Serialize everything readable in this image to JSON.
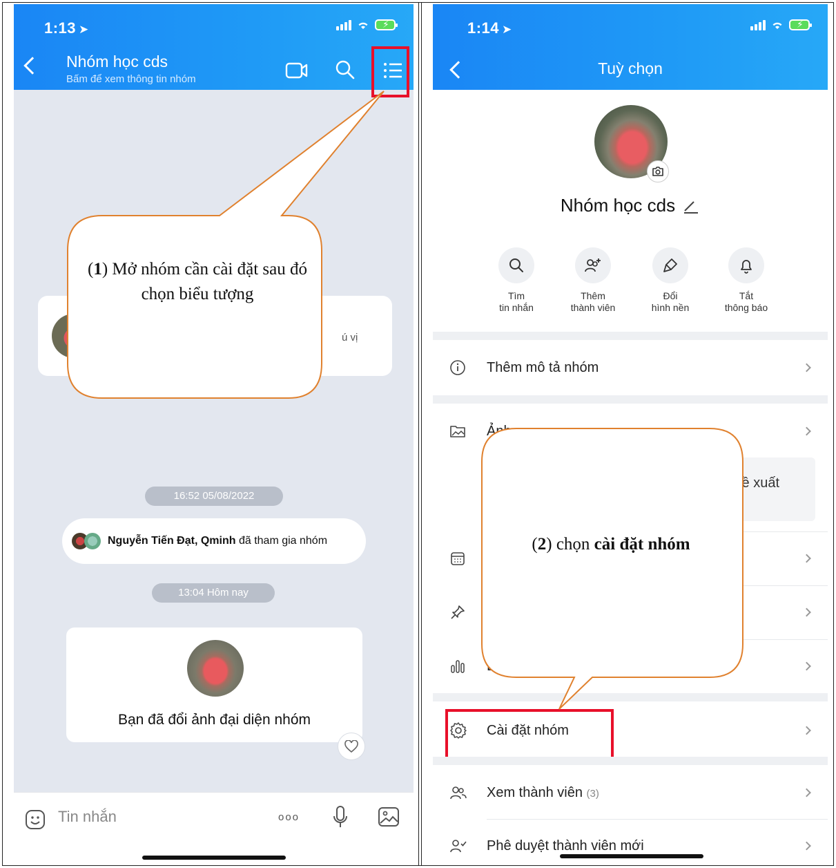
{
  "left": {
    "status_time": "1:13",
    "header": {
      "title": "Nhóm học cds",
      "subtitle": "Bấm để xem thông tin nhóm"
    },
    "messages": {
      "top_card_tail": "ú vị",
      "date_1": "16:52 05/08/2022",
      "join_names": "Nguyễn Tiến Đạt, Qminh",
      "join_action": "đã tham gia nhóm",
      "date_2": "13:04 Hôm nay",
      "change_actor": "Bạn",
      "change_action": "đã đổi ảnh đại diện nhóm"
    },
    "composer": {
      "placeholder": "Tin nhắn",
      "dots": "ooo"
    },
    "callout": {
      "step": "1",
      "prefix": "(",
      "suffix": ")",
      "text": " Mở nhóm cần cài đặt sau đó chọn biểu tượng"
    }
  },
  "right": {
    "status_time": "1:14",
    "header": {
      "title": "Tuỳ chọn"
    },
    "group_name": "Nhóm học cds",
    "quick_actions": [
      {
        "line1": "Tìm",
        "line2": "tin nhắn",
        "icon": "search-icon"
      },
      {
        "line1": "Thêm",
        "line2": "thành viên",
        "icon": "add-member-icon"
      },
      {
        "line1": "Đổi",
        "line2": "hình nền",
        "icon": "brush-icon"
      },
      {
        "line1": "Tắt",
        "line2": "thông báo",
        "icon": "bell-icon"
      }
    ],
    "rows": {
      "description": "Thêm mô tả nhóm",
      "media_partial": "Ảnh",
      "preview_partial": "ề xuất",
      "calendar_partial": "",
      "pinned_partial": "",
      "poll_partial": "B",
      "settings": "Cài đặt nhóm",
      "members": "Xem thành viên",
      "members_count": "(3)",
      "approve": "Phê duyệt thành viên mới"
    },
    "callout": {
      "step": "2",
      "prefix": "(",
      "suffix": ")",
      "text_plain": " chọn ",
      "text_bold": "cài đặt nhóm"
    }
  },
  "colors": {
    "brand_blue": "#1a86f5",
    "highlight_red": "#e8102a",
    "callout_orange": "#e0812e"
  }
}
